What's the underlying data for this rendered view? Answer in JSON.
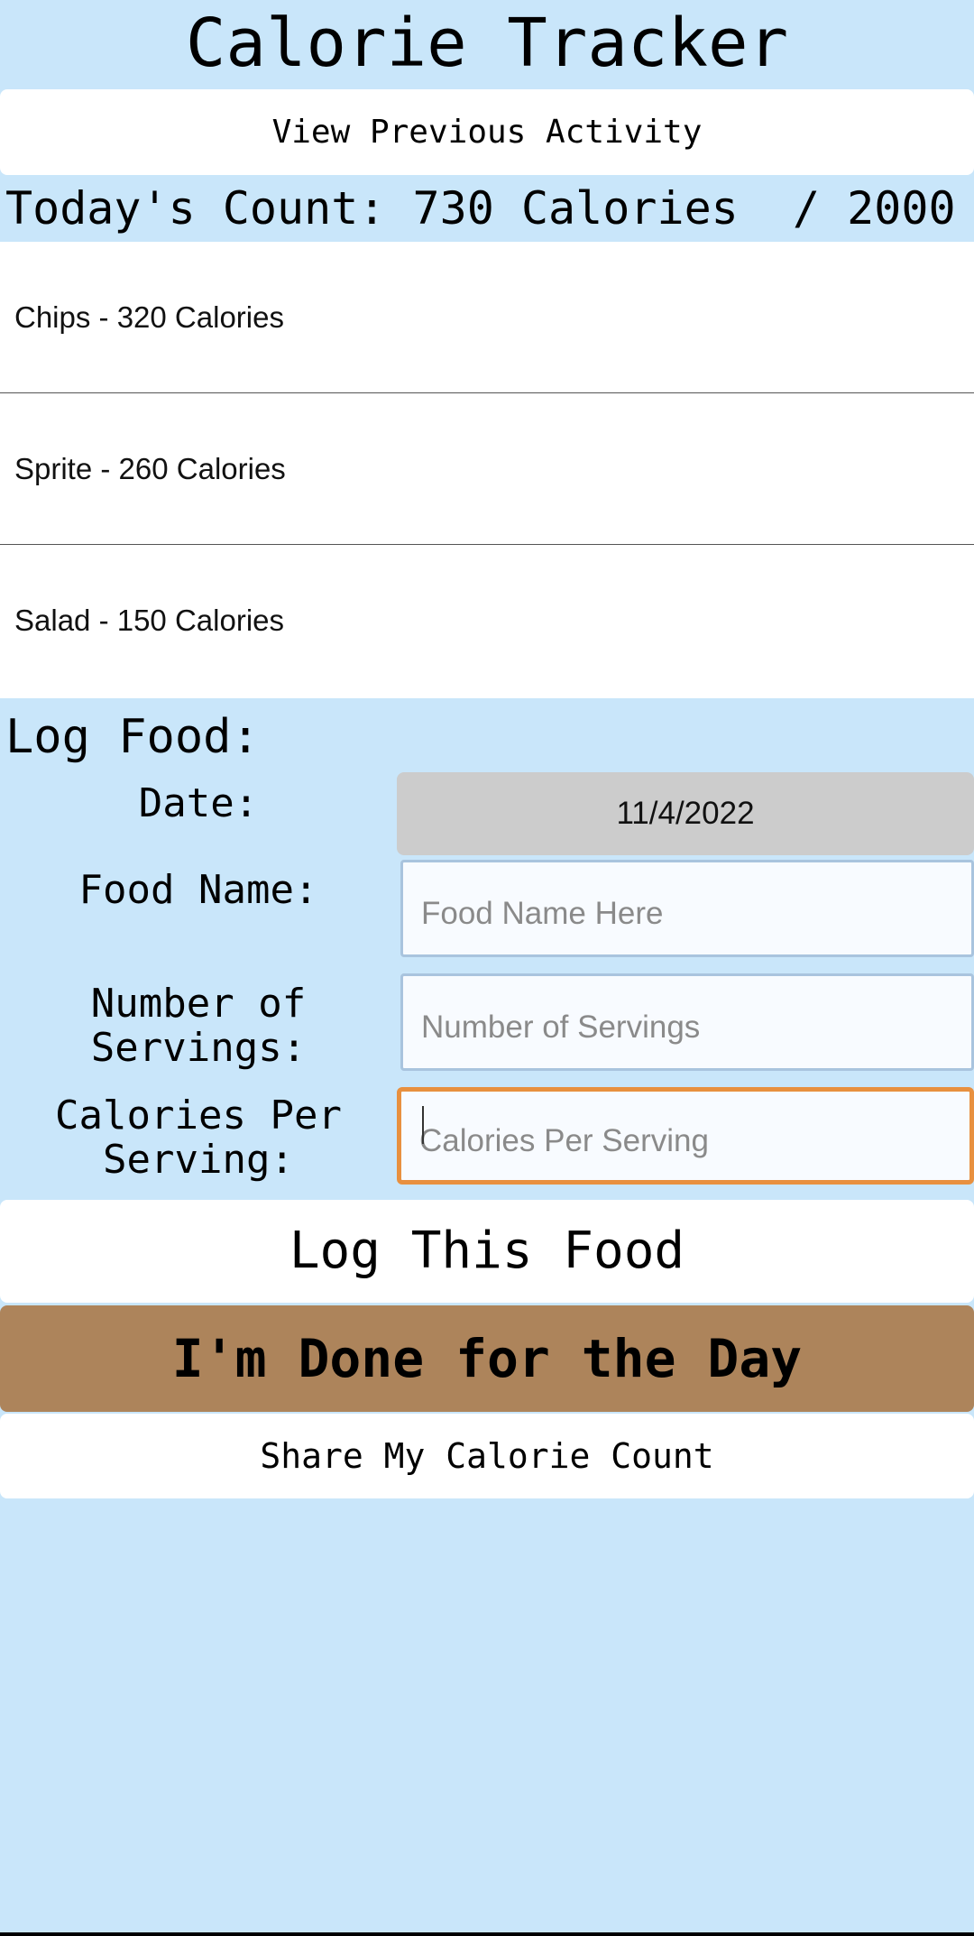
{
  "header": {
    "title": "Calorie Tracker",
    "view_previous_label": "View Previous Activity"
  },
  "summary": {
    "count_text": "Today's Count: 730 Calories  / 2000"
  },
  "food_log": {
    "items": [
      {
        "label": "Chips - 320 Calories"
      },
      {
        "label": "Sprite - 260 Calories"
      },
      {
        "label": "Salad - 150 Calories"
      }
    ]
  },
  "form": {
    "heading": "Log Food:",
    "date_label": "Date:",
    "date_value": "11/4/2022",
    "food_name_label": "Food Name:",
    "food_name_placeholder": "Food Name Here",
    "servings_label": "Number of Servings:",
    "servings_placeholder": "Number of Servings",
    "calories_label": "Calories Per Serving:",
    "calories_placeholder": "Calories Per Serving"
  },
  "actions": {
    "log_food_label": "Log This Food",
    "done_label": "I'm Done for the Day",
    "share_label": "Share My Calorie Count"
  },
  "colors": {
    "background": "#c9e6fa",
    "done_button": "#ad845b",
    "focus_border": "#e8903f"
  }
}
